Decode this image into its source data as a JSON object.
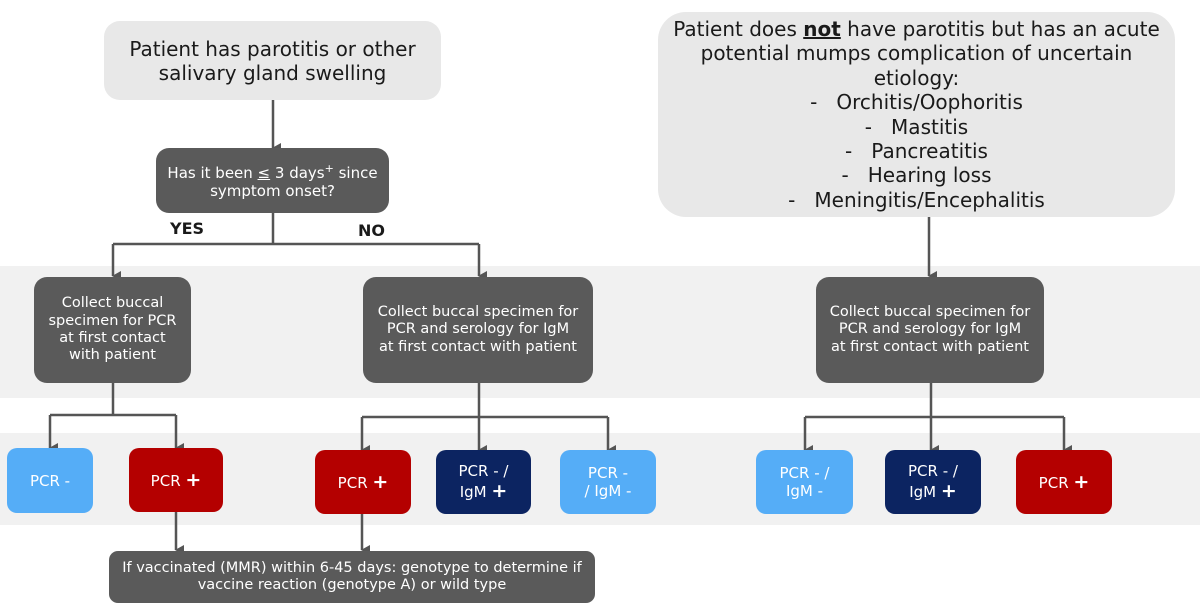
{
  "colors": {
    "light_box": "#e8e8e8",
    "dark_box": "#5a5a5a",
    "pcr_negative": "#55adf7",
    "pcr_positive": "#b40000",
    "igm_positive": "#0c2461",
    "band": "#f1f1f1",
    "connector": "#555555"
  },
  "left_flow": {
    "start": "Patient has parotitis or other\nsalivary gland swelling",
    "question": {
      "prefix": "Has it been ",
      "le_symbol": "≤",
      "mid": " 3 days",
      "superscript": "+",
      "suffix": " since\nsymptom onset?"
    },
    "yes_label": "YES",
    "no_label": "NO",
    "yes_action": "Collect buccal\nspecimen for PCR\nat first contact\nwith patient",
    "no_action": "Collect buccal specimen for\nPCR and serology for IgM\nat first contact with patient",
    "yes_results": [
      {
        "label": "PCR -",
        "sign": ""
      },
      {
        "label": "PCR",
        "sign": "+"
      }
    ],
    "no_results": [
      {
        "label": "PCR",
        "sign": "+"
      },
      {
        "label": "PCR - /\nIgM",
        "sign": "+"
      },
      {
        "label": "PCR -\n/ IgM -",
        "sign": ""
      }
    ],
    "genotype_note": "If vaccinated (MMR) within 6-45 days: genotype to determine if\nvaccine reaction (genotype A) or wild type"
  },
  "right_flow": {
    "start": {
      "pre": "Patient does ",
      "emphasis": "not",
      "post": " have parotitis but has an acute\npotential mumps complication of uncertain\netiology:",
      "items": [
        "-   Orchitis/Oophoritis",
        "-   Mastitis",
        "-   Pancreatitis",
        "-   Hearing loss",
        "-   Meningitis/Encephalitis"
      ]
    },
    "action": "Collect buccal specimen for\nPCR and serology for IgM\nat first contact with patient",
    "results": [
      {
        "label": "PCR - /\nIgM -",
        "sign": ""
      },
      {
        "label": "PCR - /\nIgM",
        "sign": "+"
      },
      {
        "label": "PCR",
        "sign": "+"
      }
    ]
  }
}
